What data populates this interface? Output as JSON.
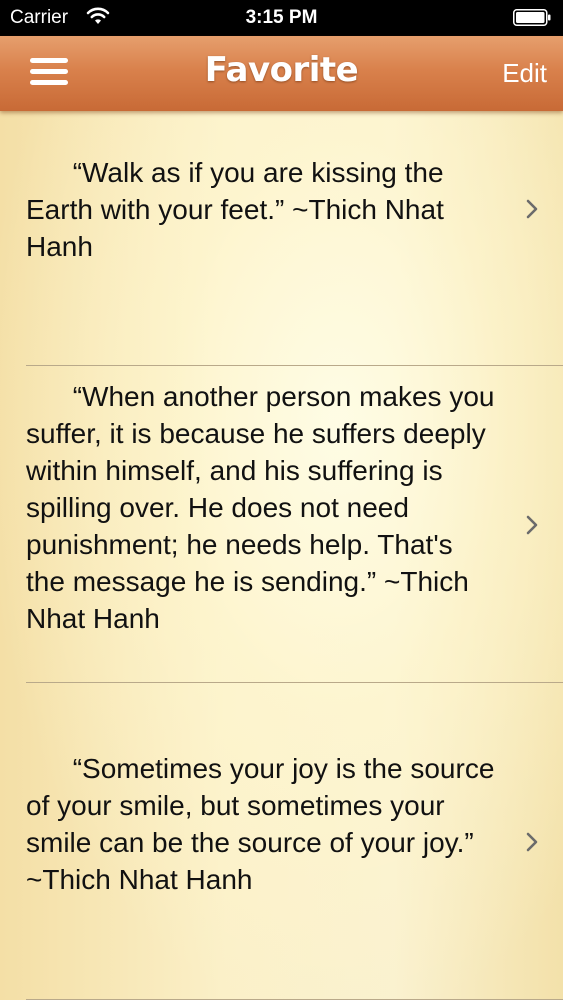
{
  "status_bar": {
    "carrier": "Carrier",
    "time": "3:15 PM",
    "wifi_icon": "wifi-icon",
    "battery_icon": "battery-icon"
  },
  "nav_bar": {
    "menu_icon": "hamburger-menu-icon",
    "title": "Favorite",
    "edit_label": "Edit",
    "colors": {
      "gradient_top": "#e69f6d",
      "gradient_bottom": "#c86a36",
      "text": "#ffffff"
    }
  },
  "quotes": [
    {
      "text": "      “Walk as if you are kissing the Earth with your feet.” ~Thich Nhat Hanh"
    },
    {
      "text": "      “When another person makes you suffer, it is because he suffers deeply within himself, and his suffering is spilling over. He does not need punishment; he needs help. That's the message he is sending.” ~Thich Nhat Hanh"
    },
    {
      "text": "      “Sometimes your joy is the source of your smile, but sometimes your smile can be the source of your joy.”  ~Thich Nhat Hanh"
    }
  ],
  "colors": {
    "background": "#f7e8b9",
    "separator": "#b9a98a",
    "chevron": "#6b6b6b"
  }
}
